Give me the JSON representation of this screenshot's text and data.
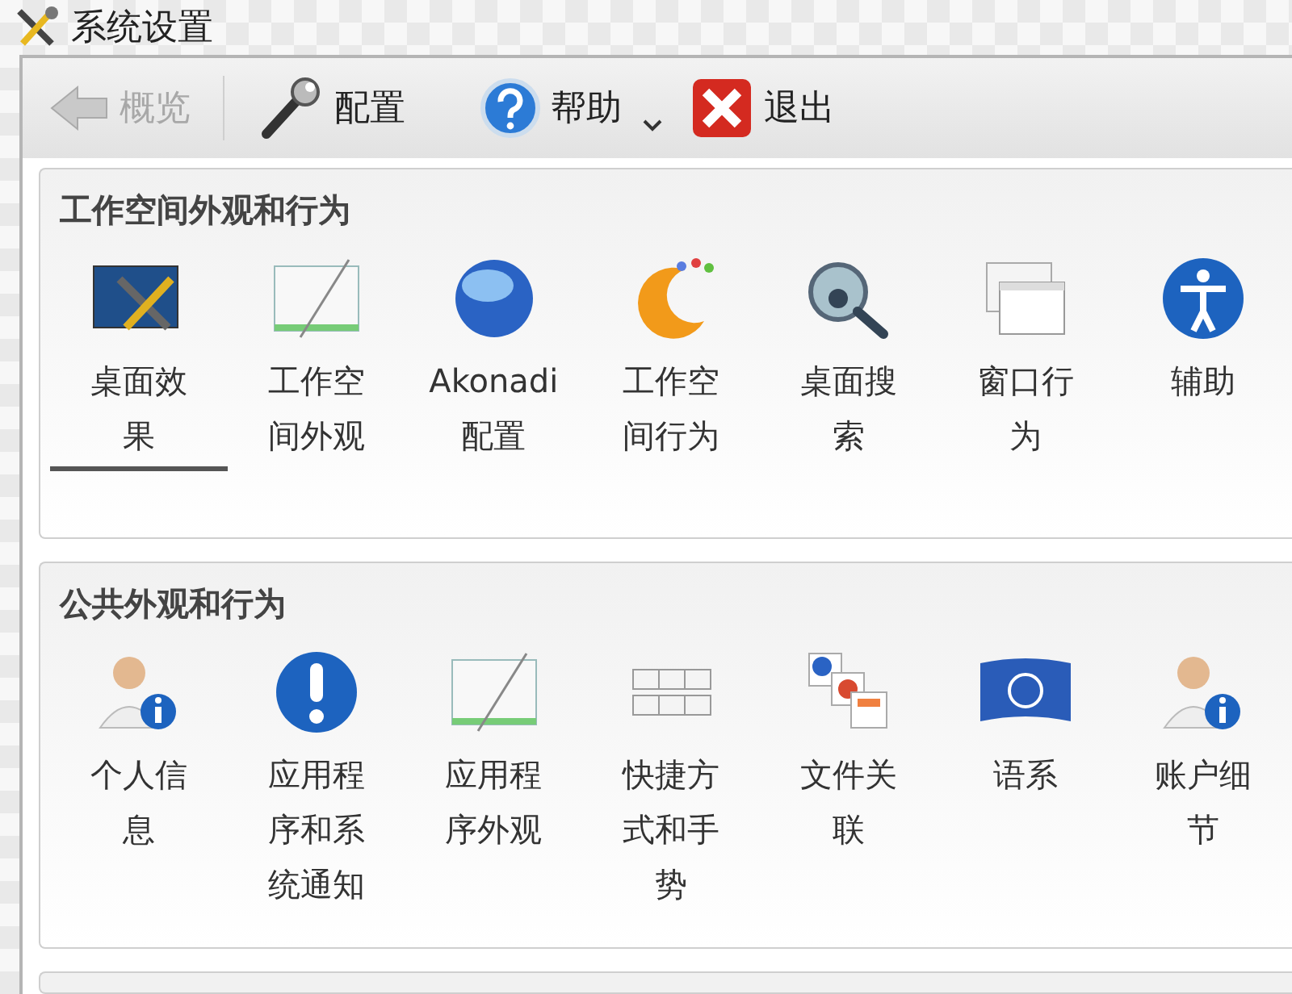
{
  "window": {
    "title": "系统设置"
  },
  "toolbar": [
    {
      "label": "概览",
      "disabled": true
    },
    {
      "label": "配置",
      "disabled": false
    },
    {
      "label": "帮助",
      "disabled": false
    },
    {
      "label": "退出",
      "disabled": false
    }
  ],
  "sections": [
    {
      "title": "工作空间外观和行为",
      "items": [
        {
          "label": "桌面效果",
          "selected": true
        },
        {
          "label": "工作空间外观",
          "selected": false
        },
        {
          "label": "Akonadi 配置",
          "selected": false
        },
        {
          "label": "工作空间行为",
          "selected": false
        },
        {
          "label": "桌面搜索",
          "selected": false
        },
        {
          "label": "窗口行为",
          "selected": false
        },
        {
          "label": "辅助",
          "selected": false
        }
      ]
    },
    {
      "title": "公共外观和行为",
      "items": [
        {
          "label": "个人信息",
          "selected": false
        },
        {
          "label": "应用程序和系统通知",
          "selected": false
        },
        {
          "label": "应用程序外观",
          "selected": false
        },
        {
          "label": "快捷方式和手势",
          "selected": false
        },
        {
          "label": "文件关联",
          "selected": false
        },
        {
          "label": "语系",
          "selected": false
        },
        {
          "label": "账户细节",
          "selected": false
        }
      ]
    }
  ]
}
